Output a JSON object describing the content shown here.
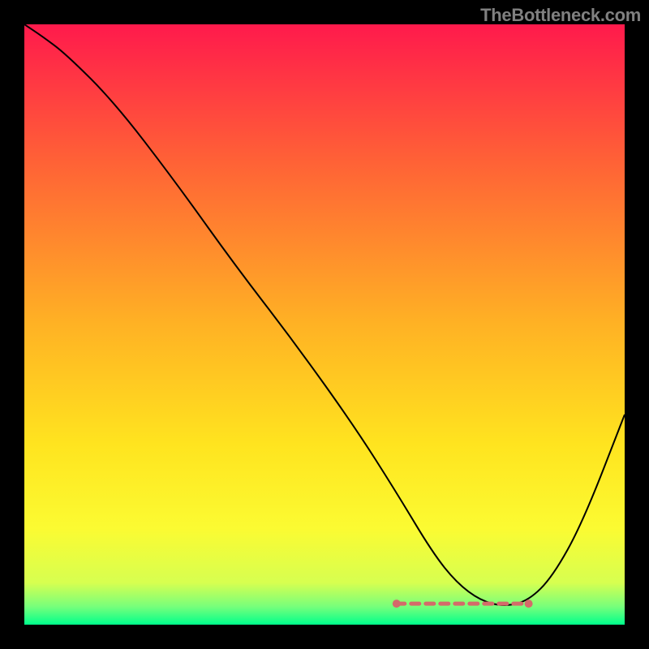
{
  "branding": {
    "watermark": "TheBottleneck.com"
  },
  "chart_data": {
    "type": "line",
    "title": "",
    "xlabel": "",
    "ylabel": "",
    "xlim": [
      0,
      100
    ],
    "ylim": [
      0,
      100
    ],
    "grid": false,
    "legend": false,
    "background": {
      "gradient_stops": [
        {
          "pos": 0,
          "color": "#ff1a4c"
        },
        {
          "pos": 23,
          "color": "#ff6236"
        },
        {
          "pos": 50,
          "color": "#ffb224"
        },
        {
          "pos": 70,
          "color": "#ffe41f"
        },
        {
          "pos": 84,
          "color": "#fbfb32"
        },
        {
          "pos": 93,
          "color": "#d7ff50"
        },
        {
          "pos": 97,
          "color": "#77ff7b"
        },
        {
          "pos": 100,
          "color": "#00ff8c"
        }
      ]
    },
    "series": [
      {
        "name": "bottleneck-curve",
        "color": "#000000",
        "width": 2,
        "x": [
          0,
          3,
          7,
          15,
          25,
          35,
          45,
          55,
          62,
          68,
          72,
          76,
          80,
          84,
          88,
          93,
          100
        ],
        "y": [
          100,
          98,
          95,
          87,
          74,
          60,
          47,
          33,
          22,
          12,
          7,
          4,
          3,
          4,
          8,
          17,
          35
        ]
      }
    ],
    "marker_band": {
      "name": "optimal-zone",
      "color": "#d46a6a",
      "x_range": [
        62,
        84
      ],
      "y": 3.5,
      "dot_radius": 4
    }
  }
}
